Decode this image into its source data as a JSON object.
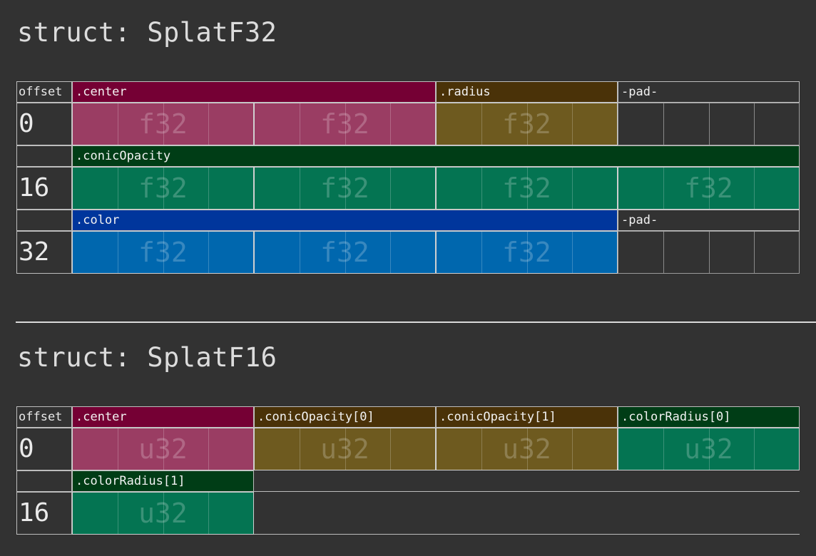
{
  "structs": [
    {
      "title": "struct: SplatF32",
      "offset_header": "offset",
      "rows": [
        {
          "offset": "0",
          "fields": [
            {
              "label": ".center",
              "type": "f32",
              "words": 2,
              "color": "#9a3d63",
              "label_color": "#750034"
            },
            {
              "label": ".radius",
              "type": "f32",
              "words": 1,
              "color": "#6e5a1f",
              "label_color": "#4a3208"
            },
            {
              "label": "-pad-",
              "type": "",
              "words": 1,
              "color": "",
              "label_color": ""
            }
          ]
        },
        {
          "offset": "16",
          "fields": [
            {
              "label": ".conicOpacity",
              "type": "f32",
              "words": 4,
              "color": "#047452",
              "label_color": "#003d16"
            }
          ]
        },
        {
          "offset": "32",
          "fields": [
            {
              "label": ".color",
              "type": "f32",
              "words": 3,
              "color": "#0067ae",
              "label_color": "#00369c"
            },
            {
              "label": "-pad-",
              "type": "",
              "words": 1,
              "color": "",
              "label_color": ""
            }
          ]
        }
      ]
    },
    {
      "title": "struct: SplatF16",
      "offset_header": "offset",
      "rows": [
        {
          "offset": "0",
          "fields": [
            {
              "label": ".center",
              "type": "u32",
              "words": 1,
              "color": "#9a3d63",
              "label_color": "#750034"
            },
            {
              "label": ".conicOpacity[0]",
              "type": "u32",
              "words": 1,
              "color": "#6e5a1f",
              "label_color": "#4a3208"
            },
            {
              "label": ".conicOpacity[1]",
              "type": "u32",
              "words": 1,
              "color": "#6e5a1f",
              "label_color": "#4a3208"
            },
            {
              "label": ".colorRadius[0]",
              "type": "u32",
              "words": 1,
              "color": "#047452",
              "label_color": "#003d16"
            }
          ]
        },
        {
          "offset": "16",
          "fields": [
            {
              "label": ".colorRadius[1]",
              "type": "u32",
              "words": 1,
              "color": "#047452",
              "label_color": "#003d16"
            }
          ]
        }
      ]
    }
  ]
}
